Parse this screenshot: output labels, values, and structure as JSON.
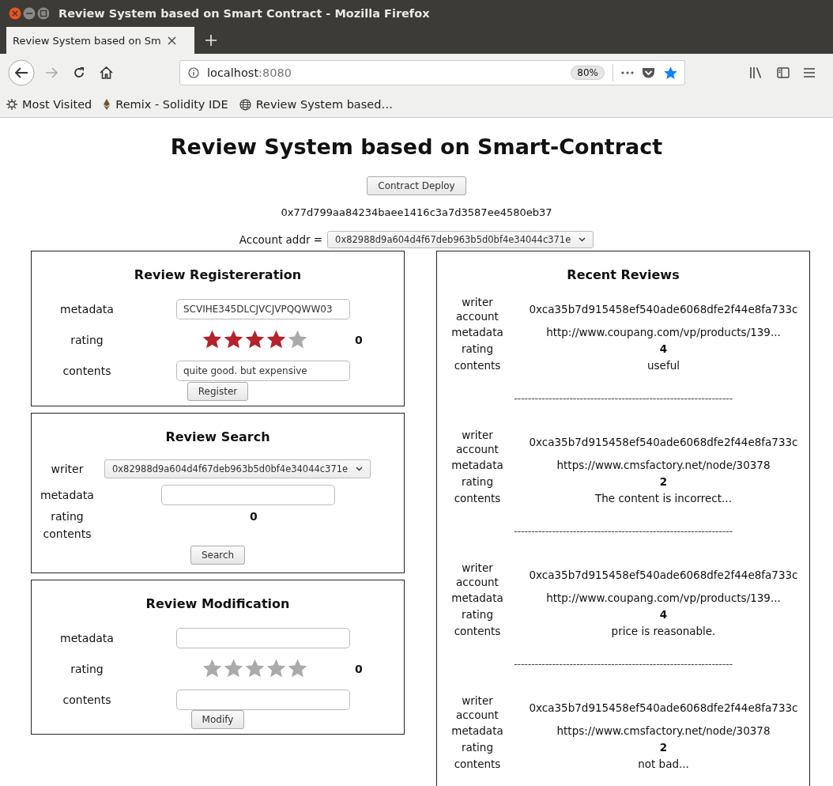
{
  "window": {
    "title": "Review System based on Smart Contract - Mozilla Firefox"
  },
  "tabs": [
    {
      "label": "Review System based on Sm",
      "selected": true
    }
  ],
  "address": {
    "host": "localhost",
    "port": ":8080",
    "zoom": "80%"
  },
  "bookmarks": [
    {
      "label": "Most Visited",
      "kind": "gear"
    },
    {
      "label": "Remix - Solidity IDE",
      "kind": "eth"
    },
    {
      "label": "Review System based…",
      "kind": "globe"
    }
  ],
  "page": {
    "heading": "Review System based on Smart-Contract",
    "deploy_button": "Contract Deploy",
    "contract_address": "0x77d799aa84234baee1416c3a7d3587ee4580eb37",
    "account": {
      "label": "Account addr =",
      "value": "0x82988d9a604d4f67deb963b5d0bf4e34044c371e"
    }
  },
  "registration": {
    "title": "Review Registereration",
    "metadata_label": "metadata",
    "metadata_value": "SCVIHE345DLCJVCJVPQQWW03",
    "rating_label": "rating",
    "stars": 4,
    "rating_value": "0",
    "contents_label": "contents",
    "contents_value": "quite good. but expensive",
    "button": "Register"
  },
  "search": {
    "title": "Review Search",
    "writer_label": "writer",
    "writer_value": "0x82988d9a604d4f67deb963b5d0bf4e34044c371e",
    "metadata_label": "metadata",
    "rating_label": "rating",
    "rating_value": "0",
    "contents_label": "contents",
    "button": "Search"
  },
  "modification": {
    "title": "Review Modification",
    "metadata_label": "metadata",
    "rating_label": "rating",
    "stars": 0,
    "rating_value": "0",
    "contents_label": "contents",
    "button": "Modify"
  },
  "recent": {
    "title": "Recent Reviews",
    "reviews": [
      {
        "writer_label": "writer account",
        "writer": "0xca35b7d915458ef540ade6068dfe2f44e8fa733c",
        "metadata_label": "metadata",
        "metadata": "http://www.coupang.com/vp/products/139...",
        "rating_label": "rating",
        "rating": "4",
        "contents_label": "contents",
        "contents": "useful",
        "separator": "---------------------------------------------------------------"
      },
      {
        "writer_label": "writer account",
        "writer": "0xca35b7d915458ef540ade6068dfe2f44e8fa733c",
        "metadata_label": "metadata",
        "metadata": "https://www.cmsfactory.net/node/30378",
        "rating_label": "rating",
        "rating": "2",
        "contents_label": "contents",
        "contents": "The content is incorrect...",
        "separator": "---------------------------------------------------------------"
      },
      {
        "writer_label": "writer account",
        "writer": "0xca35b7d915458ef540ade6068dfe2f44e8fa733c",
        "metadata_label": "metadata",
        "metadata": "http://www.coupang.com/vp/products/139...",
        "rating_label": "rating",
        "rating": "4",
        "contents_label": "contents",
        "contents": "price is reasonable.",
        "separator": "---------------------------------------------------------------"
      },
      {
        "writer_label": "writer account",
        "writer": "0xca35b7d915458ef540ade6068dfe2f44e8fa733c",
        "metadata_label": "metadata",
        "metadata": "https://www.cmsfactory.net/node/30378",
        "rating_label": "rating",
        "rating": "2",
        "contents_label": "contents",
        "contents": "not bad..."
      }
    ]
  }
}
